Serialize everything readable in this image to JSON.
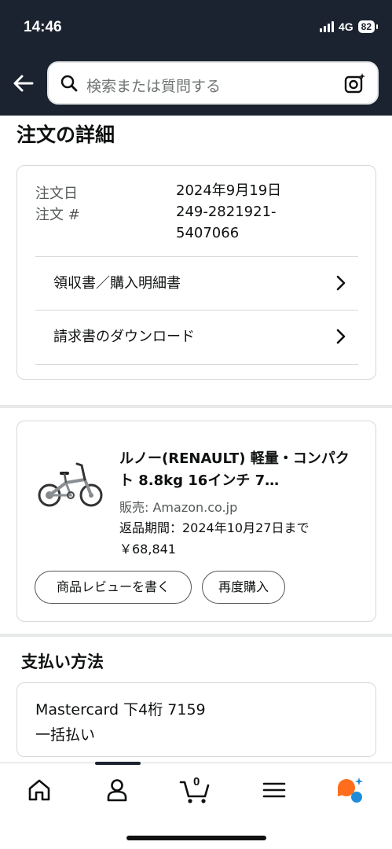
{
  "status_bar": {
    "time": "14:46",
    "network": "4G",
    "battery": "82"
  },
  "search": {
    "placeholder": "検索または質問する"
  },
  "page_title": "注文の詳細",
  "order": {
    "date_label": "注文日",
    "date_value": "2024年9月19日",
    "number_label": "注文 #",
    "number_value_line1": "249-2821921-",
    "number_value_line2": "5407066",
    "receipt_link": "領収書／購入明細書",
    "invoice_link": "請求書のダウンロード"
  },
  "item": {
    "title": "ルノー(RENAULT) 軽量・コンパクト 8.8kg 16インチ 7…",
    "seller": "販売: Amazon.co.jp",
    "return_period": "返品期間：2024年10月27日まで",
    "price": "￥68,841",
    "review_button": "商品レビューを書く",
    "rebuy_button": "再度購入"
  },
  "payment": {
    "title": "支払い方法",
    "card": "Mastercard 下4桁 7159",
    "plan": "一括払い"
  },
  "bottom_nav": {
    "icons": [
      "home-icon",
      "account-icon",
      "cart-icon",
      "menu-icon",
      "rufus-icon"
    ],
    "cart_count": "0",
    "accent": "#ff6e1c",
    "accent2": "#1f8cd8"
  }
}
